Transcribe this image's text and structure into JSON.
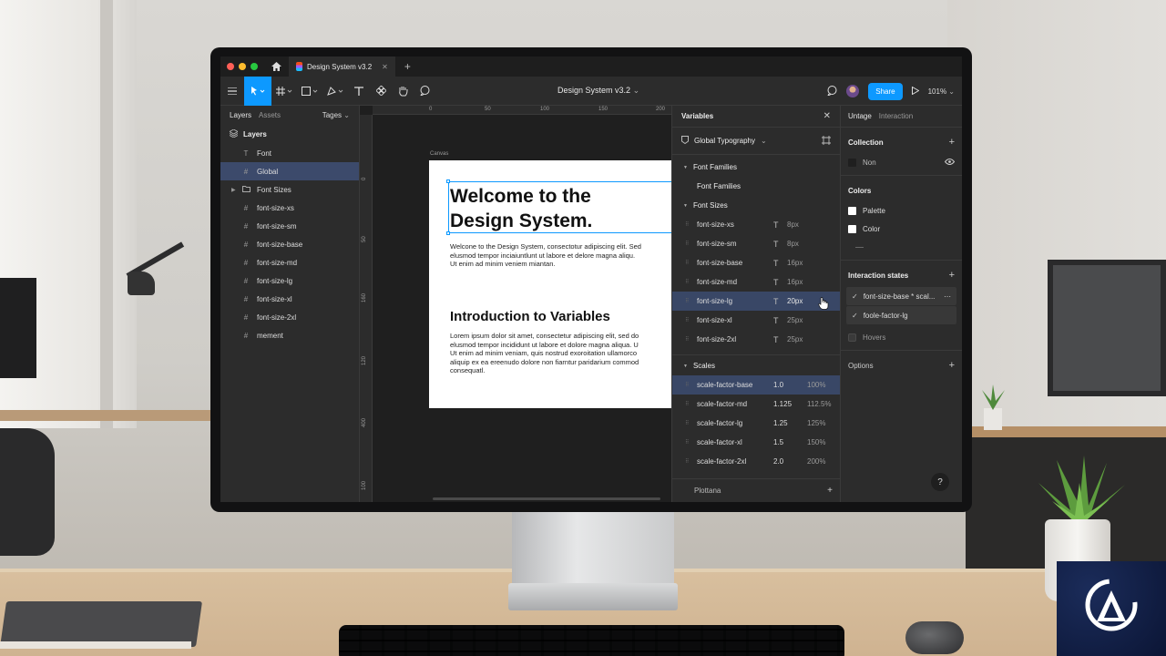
{
  "app": {
    "file_tab": "Design System v3.2",
    "doc_title": "Design System v3.2",
    "share_label": "Share",
    "zoom": "101%"
  },
  "colors": {
    "accent": "#0d99ff",
    "close_dot": "#ff5f57",
    "min_dot": "#febc2e",
    "max_dot": "#28c840",
    "selected": "#394766"
  },
  "left_panel": {
    "tabs": [
      "Layers",
      "Assets"
    ],
    "tags_label": "Tages",
    "section_title": "Layers",
    "layers": [
      {
        "label": "Font",
        "glyph": "T"
      },
      {
        "label": "Global",
        "glyph": "#"
      },
      {
        "label": "Font Sizes",
        "glyph": "folder"
      },
      {
        "label": "font-size-xs",
        "glyph": "#"
      },
      {
        "label": "font-size-sm",
        "glyph": "#"
      },
      {
        "label": "font-size-base",
        "glyph": "#"
      },
      {
        "label": "font-size-md",
        "glyph": "#"
      },
      {
        "label": "font-size-lg",
        "glyph": "#"
      },
      {
        "label": "font-size-xl",
        "glyph": "#"
      },
      {
        "label": "font-size-2xl",
        "glyph": "#"
      },
      {
        "label": "mement",
        "glyph": "#"
      }
    ]
  },
  "canvas": {
    "ruler_top": [
      "0",
      "50",
      "100",
      "150",
      "200"
    ],
    "ruler_left": [
      "0",
      "50",
      "160",
      "120",
      "400",
      "100"
    ],
    "label": "Canvas",
    "heading_1": "Welcome to the",
    "heading_2": "Design System.",
    "para1": [
      "Welcone to the Design System, consectotur adipiscing elit. Sed",
      "elusmod tempor inciaiuntlunt ut labore et delore magna aliqu.",
      "Ut enim ad minim veniem miantan."
    ],
    "heading_3": "Introduction to Variables",
    "para2": [
      "Lorem ipsum dolor sit amet, consectetur adipiscing elit, sed do",
      "elusmod tempor incididunt ut labore et dolore magna aliqua. U",
      "Ut enim ad minim veniam, quis nostrud exoroitation ullamorco",
      "aliquip ex ea ereenudo dolore non fiarntur paridarium commod",
      "consequatl."
    ]
  },
  "variables": {
    "title": "Variables",
    "collection": "Global Typography",
    "groups": {
      "font_families": "Font Families",
      "font_families_item": "Font Families",
      "font_sizes": "Font Sizes",
      "scales": "Scales"
    },
    "font_sizes": [
      {
        "name": "font-size-xs",
        "value": "8px"
      },
      {
        "name": "font-size-sm",
        "value": "8px"
      },
      {
        "name": "font-size-base",
        "value": "16px"
      },
      {
        "name": "font-size-md",
        "value": "16px"
      },
      {
        "name": "font-size-lg",
        "value": "20px"
      },
      {
        "name": "font-size-xl",
        "value": "25px"
      },
      {
        "name": "font-size-2xl",
        "value": "25px"
      }
    ],
    "type_glyph": "T",
    "scales": [
      {
        "name": "scale-factor-base",
        "a": "1.0",
        "b": "100%"
      },
      {
        "name": "scale-factor-md",
        "a": "1.125",
        "b": "112.5%"
      },
      {
        "name": "scale-factor-lg",
        "a": "1.25",
        "b": "125%"
      },
      {
        "name": "scale-factor-xl",
        "a": "1.5",
        "b": "150%"
      },
      {
        "name": "scale-factor-2xl",
        "a": "2.0",
        "b": "200%"
      }
    ],
    "footer": "Plottana"
  },
  "right_panel": {
    "tabs": [
      "Untage",
      "Interaction"
    ],
    "collection_title": "Collection",
    "collection_item": "Non",
    "colors_title": "Colors",
    "colors": [
      "Palette",
      "Color"
    ],
    "states_title": "Interaction states",
    "states": [
      "font-size-base * scal...",
      "foole-factor-lg"
    ],
    "hovers": "Hovers",
    "options_title": "Options",
    "help": "?"
  }
}
